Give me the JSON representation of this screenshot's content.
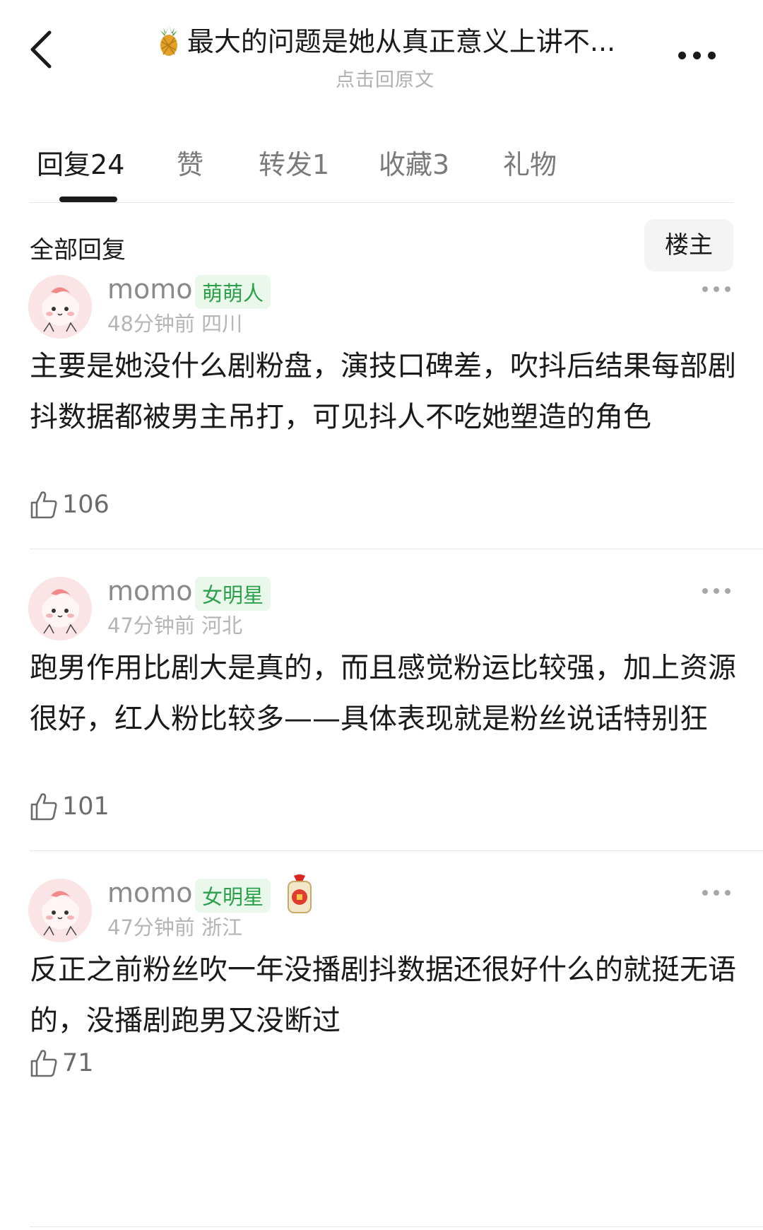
{
  "header": {
    "title": "最大的问题是她从真正意义上讲不...",
    "subtitle": "点击回原文"
  },
  "tabs": [
    {
      "label": "回复",
      "count": "24"
    },
    {
      "label": "赞",
      "count": ""
    },
    {
      "label": "转发",
      "count": "1"
    },
    {
      "label": "收藏",
      "count": "3"
    },
    {
      "label": "礼物",
      "count": ""
    }
  ],
  "filter": {
    "label": "全部回复",
    "op_button": "楼主"
  },
  "comments": [
    {
      "username": "momo",
      "badge": "萌萌人",
      "time": "48分钟前",
      "location": "四川",
      "text": "主要是她没什么剧粉盘，演技口碑差，吹抖后结果每部剧抖数据都被男主吊打，可见抖人不吃她塑造的角色",
      "likes": "106"
    },
    {
      "username": "momo",
      "badge": "女明星",
      "time": "47分钟前",
      "location": "河北",
      "text": "跑男作用比剧大是真的，而且感觉粉运比较强，加上资源很好，红人粉比较多——具体表现就是粉丝说话特别狂",
      "likes": "101"
    },
    {
      "username": "momo",
      "badge": "女明星",
      "time": "47分钟前",
      "location": "浙江",
      "text": "反正之前粉丝吹一年没播剧抖数据还很好什么的就挺无语的，没播剧跑男又没断过",
      "likes": "71"
    }
  ],
  "icons": {
    "back": "chevron-left-icon",
    "more": "more-horizontal-icon",
    "like": "thumbs-up-icon",
    "title_emoji": "pineapple-icon",
    "gift": "lucky-bag-icon"
  }
}
